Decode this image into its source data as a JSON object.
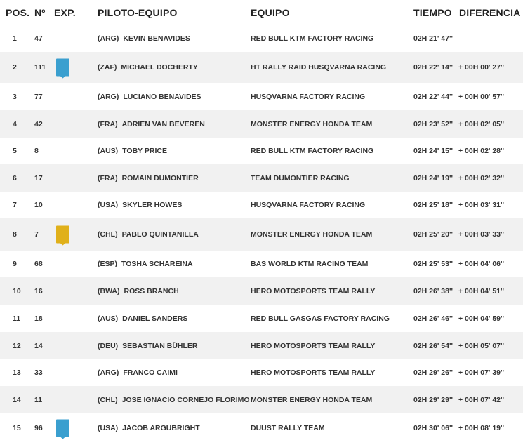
{
  "headers": {
    "pos": "POS.",
    "num": "Nº",
    "exp": "EXP.",
    "pilot": "PILOTO-EQUIPO",
    "team": "EQUIPO",
    "time": "TIEMPO",
    "diff": "DIFERENCIA"
  },
  "badge_colors": {
    "blue": "#3a9fcf",
    "yellow": "#e0b01a"
  },
  "rows": [
    {
      "pos": "1",
      "num": "47",
      "exp": "",
      "country": "(ARG)",
      "pilot": "KEVIN BENAVIDES",
      "team": "RED BULL KTM FACTORY RACING",
      "time": "02H 21' 47''",
      "diff": ""
    },
    {
      "pos": "2",
      "num": "111",
      "exp": "blue",
      "country": "(ZAF)",
      "pilot": "MICHAEL DOCHERTY",
      "team": "HT RALLY RAID HUSQVARNA RACING",
      "time": "02H 22' 14''",
      "diff": "+ 00H 00' 27''"
    },
    {
      "pos": "3",
      "num": "77",
      "exp": "",
      "country": "(ARG)",
      "pilot": "LUCIANO BENAVIDES",
      "team": "HUSQVARNA FACTORY RACING",
      "time": "02H 22' 44''",
      "diff": "+ 00H 00' 57''"
    },
    {
      "pos": "4",
      "num": "42",
      "exp": "",
      "country": "(FRA)",
      "pilot": "ADRIEN VAN BEVEREN",
      "team": "MONSTER ENERGY HONDA TEAM",
      "time": "02H 23' 52''",
      "diff": "+ 00H 02' 05''"
    },
    {
      "pos": "5",
      "num": "8",
      "exp": "",
      "country": "(AUS)",
      "pilot": "TOBY PRICE",
      "team": "RED BULL KTM FACTORY RACING",
      "time": "02H 24' 15''",
      "diff": "+ 00H 02' 28''"
    },
    {
      "pos": "6",
      "num": "17",
      "exp": "",
      "country": "(FRA)",
      "pilot": "ROMAIN DUMONTIER",
      "team": "TEAM DUMONTIER RACING",
      "time": "02H 24' 19''",
      "diff": "+ 00H 02' 32''"
    },
    {
      "pos": "7",
      "num": "10",
      "exp": "",
      "country": "(USA)",
      "pilot": "SKYLER HOWES",
      "team": "HUSQVARNA FACTORY RACING",
      "time": "02H 25' 18''",
      "diff": "+ 00H 03' 31''"
    },
    {
      "pos": "8",
      "num": "7",
      "exp": "yellow",
      "country": "(CHL)",
      "pilot": "PABLO QUINTANILLA",
      "team": "MONSTER ENERGY HONDA TEAM",
      "time": "02H 25' 20''",
      "diff": "+ 00H 03' 33''"
    },
    {
      "pos": "9",
      "num": "68",
      "exp": "",
      "country": "(ESP)",
      "pilot": "TOSHA SCHAREINA",
      "team": "BAS WORLD KTM RACING TEAM",
      "time": "02H 25' 53''",
      "diff": "+ 00H 04' 06''"
    },
    {
      "pos": "10",
      "num": "16",
      "exp": "",
      "country": "(BWA)",
      "pilot": "ROSS BRANCH",
      "team": "HERO MOTOSPORTS TEAM RALLY",
      "time": "02H 26' 38''",
      "diff": "+ 00H 04' 51''"
    },
    {
      "pos": "11",
      "num": "18",
      "exp": "",
      "country": "(AUS)",
      "pilot": "DANIEL SANDERS",
      "team": "RED BULL GASGAS FACTORY RACING",
      "time": "02H 26' 46''",
      "diff": "+ 00H 04' 59''"
    },
    {
      "pos": "12",
      "num": "14",
      "exp": "",
      "country": "(DEU)",
      "pilot": "SEBASTIAN BÜHLER",
      "team": "HERO MOTOSPORTS TEAM RALLY",
      "time": "02H 26' 54''",
      "diff": "+ 00H 05' 07''"
    },
    {
      "pos": "13",
      "num": "33",
      "exp": "",
      "country": "(ARG)",
      "pilot": "FRANCO CAIMI",
      "team": "HERO MOTOSPORTS TEAM RALLY",
      "time": "02H 29' 26''",
      "diff": "+ 00H 07' 39''"
    },
    {
      "pos": "14",
      "num": "11",
      "exp": "",
      "country": "(CHL)",
      "pilot": "JOSE IGNACIO CORNEJO FLORIMO",
      "team": "MONSTER ENERGY HONDA TEAM",
      "time": "02H 29' 29''",
      "diff": "+ 00H 07' 42''"
    },
    {
      "pos": "15",
      "num": "96",
      "exp": "blue",
      "country": "(USA)",
      "pilot": "JACOB ARGUBRIGHT",
      "team": "DUUST RALLY TEAM",
      "time": "02H 30' 06''",
      "diff": "+ 00H 08' 19''"
    }
  ]
}
